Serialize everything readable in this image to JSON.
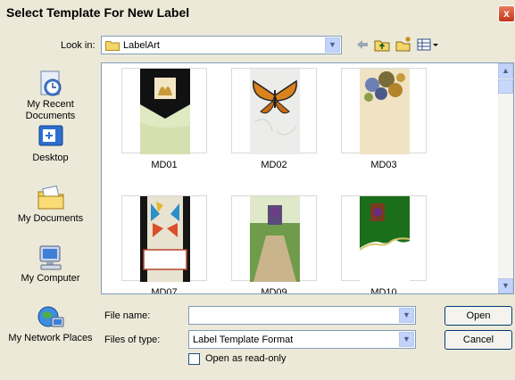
{
  "window": {
    "title": "Select Template For New Label",
    "close_glyph": "x"
  },
  "look_in": {
    "label": "Look in:",
    "value": "LabelArt"
  },
  "places": [
    {
      "label": "My Recent Documents",
      "icon": "recent-documents-icon"
    },
    {
      "label": "Desktop",
      "icon": "desktop-icon"
    },
    {
      "label": "My Documents",
      "icon": "my-documents-icon"
    },
    {
      "label": "My Computer",
      "icon": "my-computer-icon"
    },
    {
      "label": "My Network Places",
      "icon": "network-places-icon"
    }
  ],
  "files": [
    {
      "name": "MD01"
    },
    {
      "name": "MD02"
    },
    {
      "name": "MD03"
    },
    {
      "name": "MD07"
    },
    {
      "name": "MD09"
    },
    {
      "name": "MD10"
    }
  ],
  "file_name": {
    "label": "File name:",
    "value": ""
  },
  "file_type": {
    "label": "Files of type:",
    "value": "Label Template Format"
  },
  "read_only": {
    "label": "Open as read-only",
    "checked": false
  },
  "buttons": {
    "open": "Open",
    "cancel": "Cancel"
  }
}
